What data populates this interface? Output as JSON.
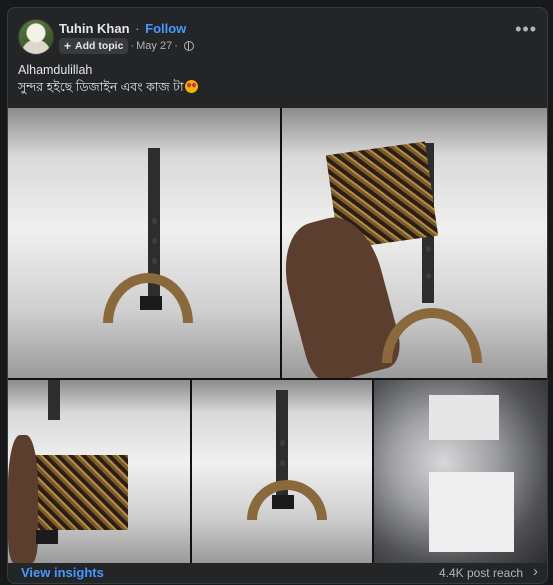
{
  "post": {
    "author": "Tuhin Khan",
    "separator": "·",
    "follow_label": "Follow",
    "add_topic_label": "Add topic",
    "date": "May 27",
    "more_glyph": "•••",
    "text_line1": "Alhamdulillah",
    "text_line2": "সুন্দর হইছে ডিজাইন এবং কাজ টা"
  },
  "footer": {
    "insights_label": "View insights",
    "reach_label": "4.4K post reach",
    "chevron_glyph": "›"
  }
}
